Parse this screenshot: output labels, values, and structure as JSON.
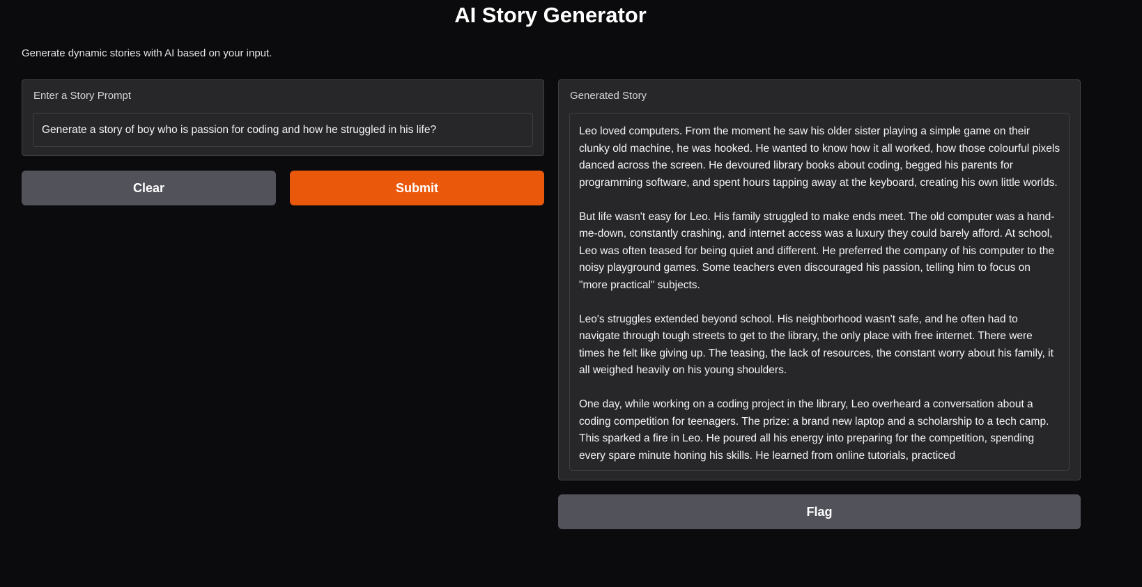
{
  "header": {
    "title": "AI Story Generator",
    "description": "Generate dynamic stories with AI based on your input."
  },
  "input": {
    "label": "Enter a Story Prompt",
    "value": "Generate a story of boy who is passion for coding and how he struggled in his life?"
  },
  "buttons": {
    "clear_label": "Clear",
    "submit_label": "Submit",
    "flag_label": "Flag"
  },
  "output": {
    "label": "Generated Story",
    "paragraphs": [
      "Leo loved computers. From the moment he saw his older sister playing a simple game on their clunky old machine, he was hooked. He wanted to know how it all worked, how those colourful pixels danced across the screen. He devoured library books about coding, begged his parents for programming software, and spent hours tapping away at the keyboard, creating his own little worlds.",
      "But life wasn't easy for Leo. His family struggled to make ends meet.  The old computer was a hand-me-down, constantly crashing, and internet access was a luxury they could barely afford.  At school, Leo was often teased for being quiet and different.  He preferred the company of his computer to the noisy playground games.  Some teachers even discouraged his passion, telling him to focus on \"more practical\" subjects.",
      "Leo's struggles extended beyond school.  His neighborhood wasn't safe, and he often had to navigate through tough streets to get to the library, the only place with free internet. There were times he felt like giving up.  The teasing, the lack of resources, the constant worry about his family, it all weighed heavily on his young shoulders.",
      "One day, while working on a coding project in the library, Leo overheard a conversation about a coding competition for teenagers. The prize: a brand new laptop and a scholarship to a tech camp. This sparked a fire in Leo.  He poured all his energy into preparing for the competition, spending every spare minute honing his skills.  He learned from online tutorials, practiced"
    ]
  },
  "colors": {
    "background": "#0b0b0d",
    "panel": "#27272a",
    "border": "#3f3f46",
    "secondary_button": "#52525b",
    "primary_button": "#ea580c"
  }
}
